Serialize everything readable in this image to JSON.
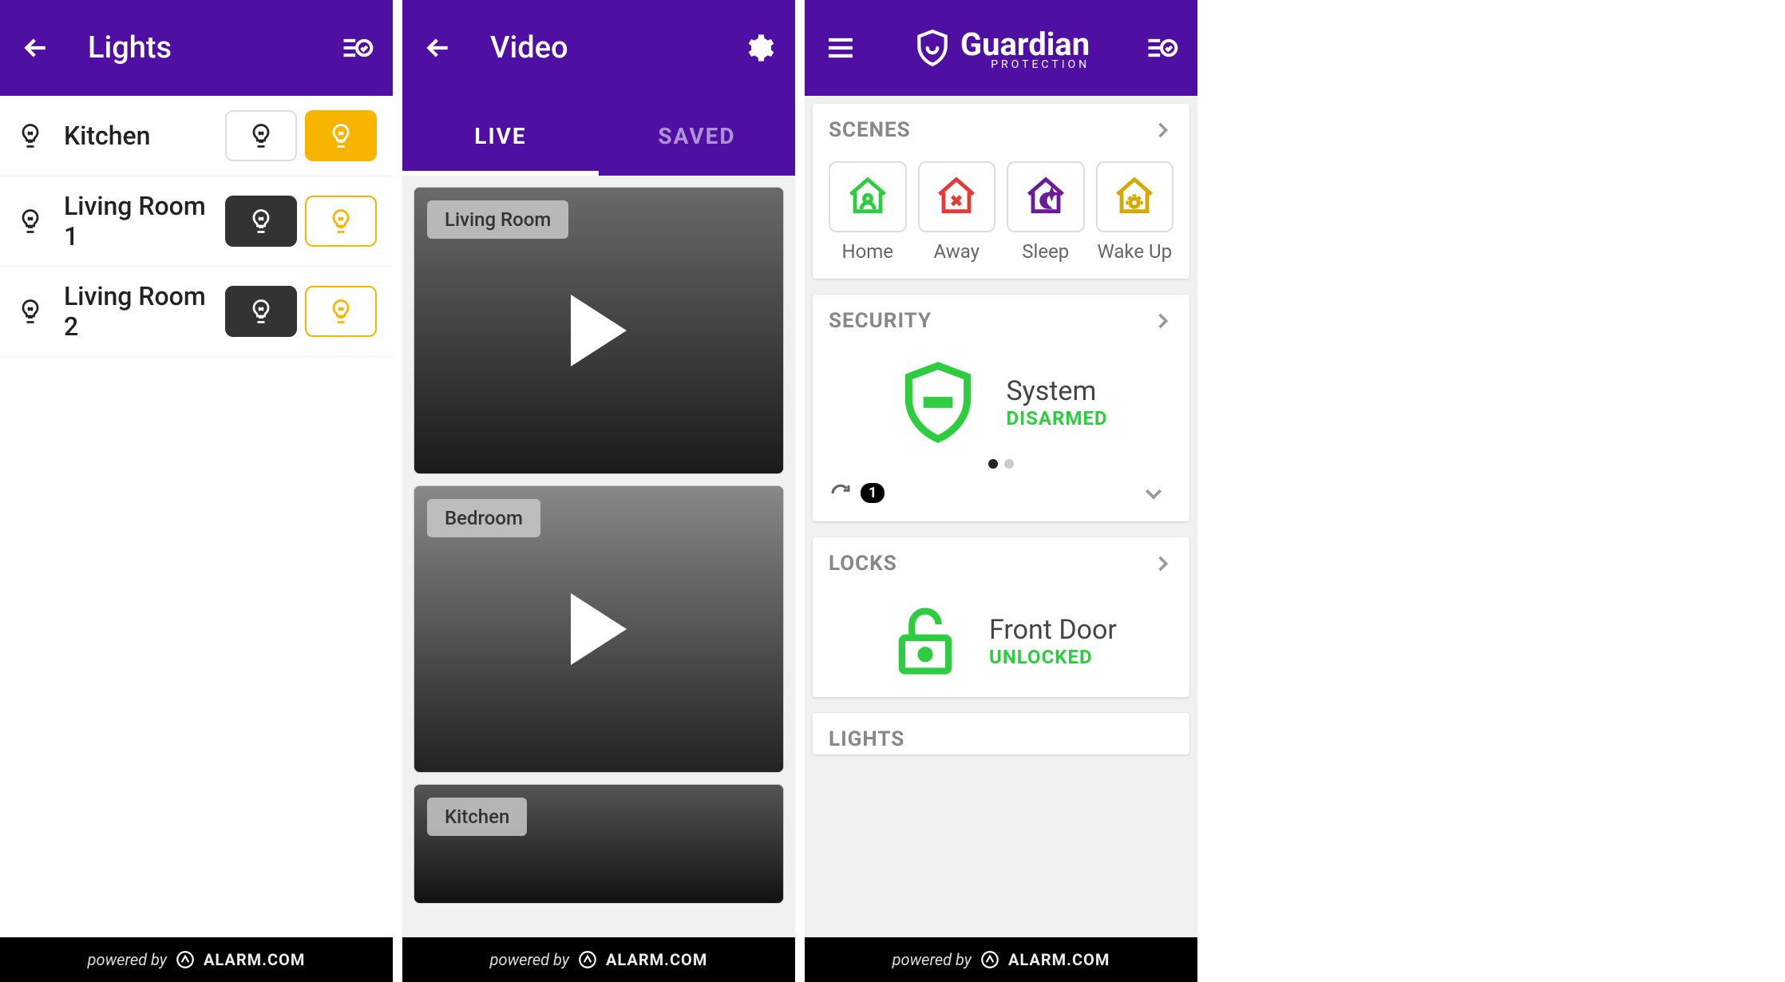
{
  "footer": {
    "powered_by": "powered by",
    "brand": "ALARM.COM"
  },
  "colors": {
    "purple": "#4f0fa3",
    "yellow": "#f7b500",
    "green": "#2ecc40",
    "red": "#e53935",
    "violet": "#6a1b9a",
    "gold": "#d6a800"
  },
  "screen1": {
    "title": "Lights",
    "lights": [
      {
        "name": "Kitchen",
        "state": "on"
      },
      {
        "name": "Living Room 1",
        "state": "off"
      },
      {
        "name": "Living Room 2",
        "state": "off"
      }
    ]
  },
  "screen2": {
    "title": "Video",
    "tabs": [
      {
        "label": "LIVE",
        "active": true
      },
      {
        "label": "SAVED",
        "active": false
      }
    ],
    "feeds": [
      {
        "label": "Living Room"
      },
      {
        "label": "Bedroom"
      },
      {
        "label": "Kitchen"
      }
    ]
  },
  "screen3": {
    "logo": {
      "name": "Guardian",
      "sub": "PROTECTION"
    },
    "cards": {
      "scenes": {
        "title": "SCENES",
        "items": [
          {
            "label": "Home",
            "icon": "home-person",
            "color": "#2ecc40"
          },
          {
            "label": "Away",
            "icon": "home-x",
            "color": "#e53935"
          },
          {
            "label": "Sleep",
            "icon": "home-moon",
            "color": "#6a1b9a"
          },
          {
            "label": "Wake Up",
            "icon": "home-sun",
            "color": "#d6a800"
          }
        ]
      },
      "security": {
        "title": "SECURITY",
        "system_label": "System",
        "status": "DISARMED",
        "status_color": "#2ecc40",
        "badge_count": "1",
        "page_dots": 2,
        "active_dot": 0
      },
      "locks": {
        "title": "LOCKS",
        "lock_label": "Front Door",
        "status": "UNLOCKED",
        "status_color": "#2ecc40"
      },
      "lights": {
        "title": "LIGHTS"
      }
    }
  }
}
